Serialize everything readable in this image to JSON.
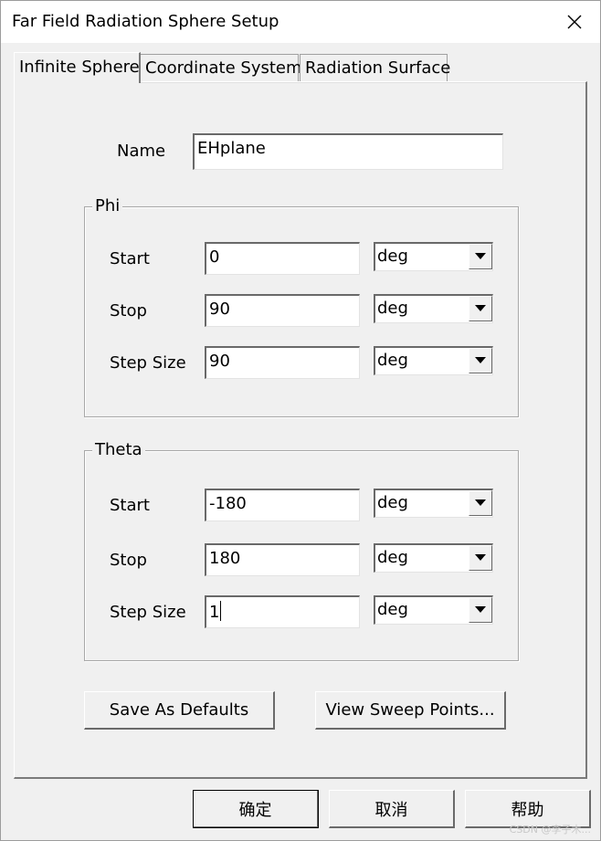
{
  "window": {
    "title": "Far Field Radiation Sphere Setup"
  },
  "tabs": [
    {
      "label": "Infinite Sphere"
    },
    {
      "label": "Coordinate System"
    },
    {
      "label": "Radiation Surface"
    }
  ],
  "name_field": {
    "label": "Name",
    "value": "EHplane"
  },
  "phi": {
    "title": "Phi",
    "rows": [
      {
        "label": "Start",
        "value": "0",
        "unit": "deg"
      },
      {
        "label": "Stop",
        "value": "90",
        "unit": "deg"
      },
      {
        "label": "Step Size",
        "value": "90",
        "unit": "deg"
      }
    ]
  },
  "theta": {
    "title": "Theta",
    "rows": [
      {
        "label": "Start",
        "value": "-180",
        "unit": "deg"
      },
      {
        "label": "Stop",
        "value": "180",
        "unit": "deg"
      },
      {
        "label": "Step Size",
        "value": "1",
        "unit": "deg"
      }
    ]
  },
  "buttons": {
    "save_defaults": "Save As Defaults",
    "view_sweep": "View Sweep Points...",
    "ok": "确定",
    "cancel": "取消",
    "help": "帮助"
  },
  "icons": {
    "close": "close-icon",
    "dropdown": "chevron-down-icon"
  },
  "watermark": "CSDN @李子木..."
}
